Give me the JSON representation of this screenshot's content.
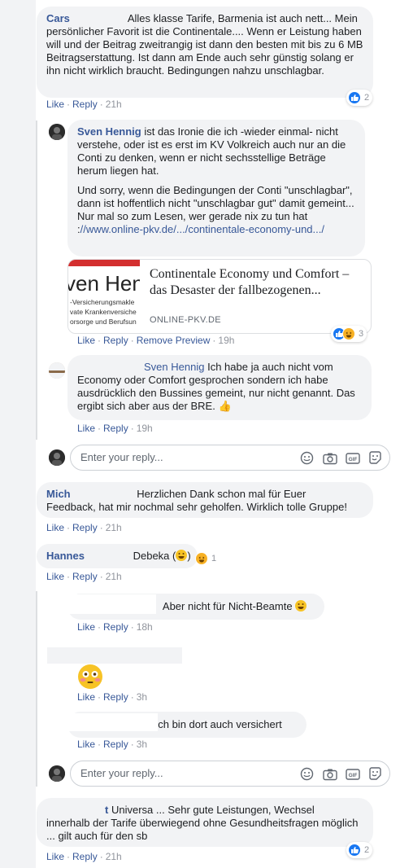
{
  "actions": {
    "like": "Like",
    "reply": "Reply",
    "remove_preview": "Remove Preview",
    "sep": "·"
  },
  "comments": [
    {
      "name": "Cars",
      "text_line1": "Alles klasse Tarife, Barmenia ist auch nett... Mein",
      "text_rest": "persönlicher Favorit ist die Continentale.... Wenn er Leistung haben will und der Beitrag zweitrangig ist dann den besten mit bis zu 6 MB Beitragserstattung. Ist dann am Ende auch sehr günstig solang er ihn nicht wirklich braucht. Bedingungen nahzu unschlagbar.",
      "time": "21h",
      "reactions": "2"
    },
    {
      "name": "Sven Hennig",
      "text": "ist das Ironie die ich -wieder einmal- nicht verstehe, oder ist es erst im KV Volkreich auch nur an die Conti zu denken, wenn er nicht sechsstellige Beträge herum liegen hat.",
      "text2": "Und sorry, wenn die Bedingungen der Conti \"unschlagbar\", dann ist hoffentlich nicht \"unschlagbar gut\" damit gemeint... Nur mal so zum Lesen, wer gerade nix zu tun hat :",
      "link": "//www.online-pkv.de/.../continentale-economy-und.../",
      "card": {
        "title": "Continentale Economy und Comfort – das Desaster der fallbezogenen...",
        "domain": "ONLINE-PKV.DE",
        "img_big": "ven Henni",
        "img_line1": "-Versicherungsmakle",
        "img_line2": "vate Krankenversiche",
        "img_line3": "orsorge und Berufsun"
      },
      "time": "19h",
      "reactions": "3"
    },
    {
      "mention": "Sven Hennig",
      "text": "Ich habe ja auch nicht vom Economy oder Comfort gesprochen sondern ich habe ausdrücklich den Bussines gemeint, nur nicht genannt. Das ergibt sich aber aus der BRE.",
      "thumb": "👍",
      "time": "19h"
    },
    {
      "name": "Mich",
      "text_line1": "Herzlichen Dank schon mal für Euer",
      "text_rest": "Feedback, hat mir nochmal sehr geholfen. Wirklich tolle Gruppe!",
      "time": "21h"
    },
    {
      "name": "Hannes",
      "text": "Debeka (",
      "text_end": ")",
      "time": "21h",
      "reactions": "1"
    },
    {
      "text": "Aber nicht für Nicht-Beamte",
      "time": "18h"
    },
    {
      "time": "3h"
    },
    {
      "text": "Ich bin dort auch versichert",
      "time": "3h"
    },
    {
      "name": "t",
      "text_line1": "Universa ... Sehr gute Leistungen, Wechsel",
      "text_rest": "innerhalb der Tarife überwiegend ohne Gesundheitsfragen möglich ... gilt auch für den sb",
      "time": "21h",
      "reactions": "2"
    }
  ],
  "reply_box": {
    "placeholder": "Enter your reply..."
  },
  "icons": [
    "smiley-icon",
    "camera-icon",
    "gif-icon",
    "sticker-icon",
    "like-icon",
    "haha-icon",
    "flushed-emoji-icon",
    "grin-emoji-icon"
  ],
  "colors": {
    "link": "#385898",
    "bubble": "#f2f3f5",
    "like_blue": "#1877f2",
    "meta": "#90949c"
  }
}
